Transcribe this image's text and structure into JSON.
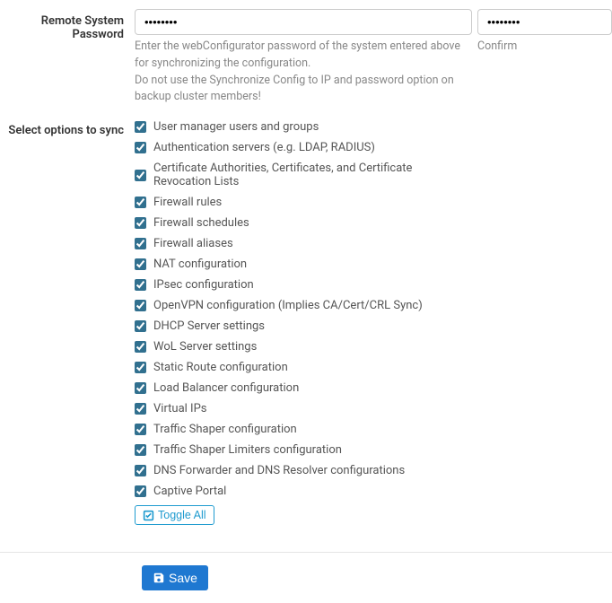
{
  "password": {
    "label_line1": "Remote System",
    "label_line2": "Password",
    "value": "••••••••",
    "help1": "Enter the webConfigurator password of the system entered above for synchronizing the configuration.",
    "help2": "Do not use the Synchronize Config to IP and password option on backup cluster members!",
    "confirm_value": "••••••••",
    "confirm_label": "Confirm"
  },
  "sync": {
    "label": "Select options to sync",
    "options": [
      "User manager users and groups",
      "Authentication servers (e.g. LDAP, RADIUS)",
      "Certificate Authorities, Certificates, and Certificate Revocation Lists",
      "Firewall rules",
      "Firewall schedules",
      "Firewall aliases",
      "NAT configuration",
      "IPsec configuration",
      "OpenVPN configuration (Implies CA/Cert/CRL Sync)",
      "DHCP Server settings",
      "WoL Server settings",
      "Static Route configuration",
      "Load Balancer configuration",
      "Virtual IPs",
      "Traffic Shaper configuration",
      "Traffic Shaper Limiters configuration",
      "DNS Forwarder and DNS Resolver configurations",
      "Captive Portal"
    ],
    "toggle_label": "Toggle All"
  },
  "save": {
    "label": "Save"
  }
}
